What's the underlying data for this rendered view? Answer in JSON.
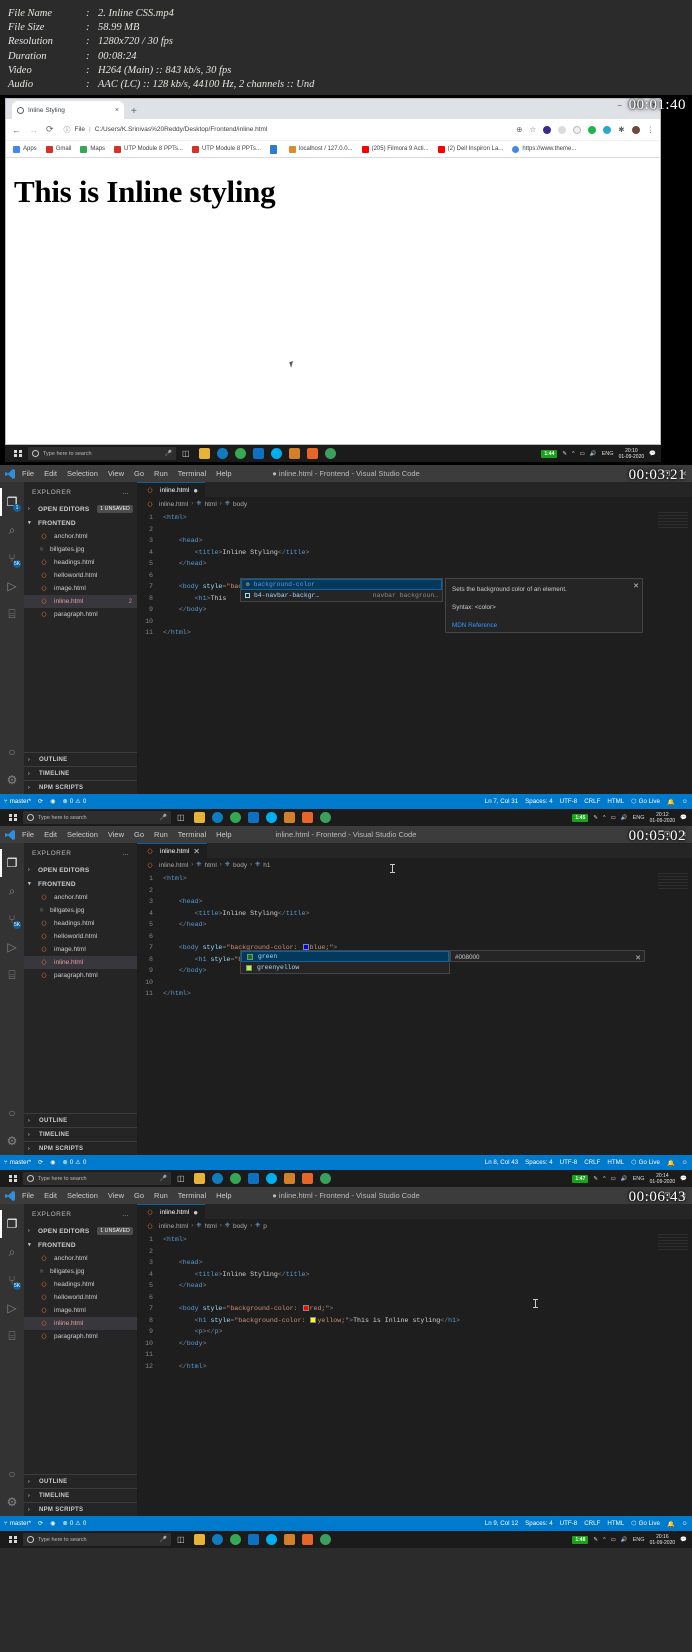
{
  "meta": {
    "rows": [
      {
        "key": "File Name",
        "sep": ":",
        "value": "2. Inline CSS.mp4"
      },
      {
        "key": "File Size",
        "sep": ":",
        "value": "58.99 MB"
      },
      {
        "key": "Resolution",
        "sep": ":",
        "value": "1280x720 / 30 fps"
      },
      {
        "key": "Duration",
        "sep": ":",
        "value": "00:08:24"
      },
      {
        "key": "Video",
        "sep": ":",
        "value": "H264 (Main) :: 843 kb/s, 30 fps"
      },
      {
        "key": "Audio",
        "sep": ":",
        "value": "AAC (LC) :: 128 kb/s, 44100 Hz, 2 channels :: Und"
      }
    ]
  },
  "panels": [
    {
      "timestamp": "00:01:40"
    },
    {
      "timestamp": "00:03:21"
    },
    {
      "timestamp": "00:05:02"
    },
    {
      "timestamp": "00:06:43"
    }
  ],
  "browser": {
    "tab_title": "Inline Styling",
    "tab_close": "×",
    "new_tab": "+",
    "window_min": "–",
    "window_max": "☐",
    "window_close": "×",
    "back": "←",
    "forward": "→",
    "reload": "⟳",
    "security_label": "File",
    "separator": "|",
    "url": "C:/Users/K.Srinivas%20Reddy/Desktop/Frontend/inline.html",
    "zoom_icon": "⊕",
    "star_icon": "☆",
    "menu_icon": "⋮",
    "bookmarks": [
      {
        "label": "Apps",
        "color": "#4285f4"
      },
      {
        "label": "Gmail",
        "color": "#d93025"
      },
      {
        "label": "Maps",
        "color": "#34a853"
      },
      {
        "label": "UTP Module 8 PPTs...",
        "color": "#d93025"
      },
      {
        "label": "UTP Module 8 PPTs...",
        "color": "#d93025"
      },
      {
        "label": "",
        "color": "#2b7cd3"
      },
      {
        "label": "localhost / 127.0.0...",
        "color": "#e08b2a"
      },
      {
        "label": "(205) Filmora 9 Acti...",
        "color": "#ff0000"
      },
      {
        "label": "(2) Dell Inspiron La...",
        "color": "#ff0000"
      },
      {
        "label": "https://www.theme...",
        "color": "#4285f4"
      }
    ],
    "page_heading": "This is Inline styling"
  },
  "taskbar": {
    "search_placeholder": "Type here to search",
    "mic_icon": "ᴿ",
    "taskview_icon": "❐",
    "apps": [
      {
        "name": "file-explorer-icon",
        "color": "#e8b339"
      },
      {
        "name": "edge-icon",
        "color": "#0f7cbf"
      },
      {
        "name": "chrome-icon",
        "color": "#34a853"
      },
      {
        "name": "vscode-icon",
        "color": "#0e70c0"
      },
      {
        "name": "skype-icon",
        "color": "#00aff0"
      },
      {
        "name": "photos-icon",
        "color": "#d4802a"
      },
      {
        "name": "filmora-icon",
        "color": "#e8652a"
      },
      {
        "name": "browser2-icon",
        "color": "#3ba05b"
      }
    ],
    "battery": "1:44",
    "lang": "ENG",
    "time": "20:10",
    "date": "01-09-2020",
    "battery_panels": [
      "1:44",
      "1:45",
      "1:47",
      "1:48"
    ],
    "times": [
      "20:10",
      "20:12",
      "20:14",
      "20:16"
    ],
    "dates": [
      "01-09-2020",
      "01-09-2020",
      "01-09-2020",
      "01-09-2020"
    ]
  },
  "vscode": {
    "menus": [
      "File",
      "Edit",
      "Selection",
      "View",
      "Go",
      "Run",
      "Terminal",
      "Help"
    ],
    "window_title": "inline.html - Frontend - Visual Studio Code",
    "window_title_dirty_dot": "●",
    "win_min": "—",
    "win_max": "❐",
    "win_close": "✕",
    "activity_icons": [
      {
        "name": "explorer-icon",
        "glyph": "❐",
        "badge": "1"
      },
      {
        "name": "search-icon",
        "glyph": "⌕",
        "badge": ""
      },
      {
        "name": "source-control-icon",
        "glyph": "⑂",
        "badge": "5K"
      },
      {
        "name": "run-debug-icon",
        "glyph": "▷",
        "badge": ""
      },
      {
        "name": "extensions-icon",
        "glyph": "⌸",
        "badge": ""
      }
    ],
    "account_icon": "○",
    "settings_icon": "⚙",
    "explorer_label": "EXPLORER",
    "explorer_more": "…",
    "open_editors": "OPEN EDITORS",
    "folder_name": "FRONTEND",
    "files": [
      {
        "name": "anchor.html",
        "type": "html",
        "count": ""
      },
      {
        "name": "billgates.jpg",
        "type": "img",
        "count": ""
      },
      {
        "name": "headings.html",
        "type": "html",
        "count": ""
      },
      {
        "name": "helloworld.html",
        "type": "html",
        "count": ""
      },
      {
        "name": "image.html",
        "type": "html",
        "count": ""
      },
      {
        "name": "inline.html",
        "type": "html",
        "count": "2"
      },
      {
        "name": "paragraph.html",
        "type": "html",
        "count": ""
      }
    ],
    "bottom_panes": [
      "OUTLINE",
      "TIMELINE",
      "NPM SCRIPTS"
    ],
    "tab_name": "inline.html",
    "tab_dirty": "●",
    "tab_close": "✕",
    "chev": "›",
    "file_icon_glyph": "‹›"
  },
  "panel2": {
    "timestamp": "00:03:21",
    "unsaved_badge": "1 UNSAVED",
    "breadcrumb": [
      "inline.html",
      "html",
      "body"
    ],
    "editor_dirty": true,
    "lines": [
      {
        "n": "1",
        "code": "<html>"
      },
      {
        "n": "2",
        "code": ""
      },
      {
        "n": "3",
        "code": "    <head>"
      },
      {
        "n": "4",
        "code": "        <title>Inline Styling</title>"
      },
      {
        "n": "5",
        "code": "    </head>"
      },
      {
        "n": "6",
        "code": ""
      },
      {
        "n": "7",
        "code": "    <body style=\"backgroundcol\">"
      },
      {
        "n": "8",
        "code": "        <h1>This is Inline styling</h1>"
      },
      {
        "n": "9",
        "code": "    </body>"
      },
      {
        "n": "10",
        "code": ""
      },
      {
        "n": "11",
        "code": "</html>"
      }
    ],
    "autocomplete": {
      "items": [
        {
          "label": "background-color",
          "highlight": "background-col",
          "detail": "",
          "icon": "wrench",
          "selected": true
        },
        {
          "label": "b4-navbar-backgr…",
          "highlight": "b4-navbar-backgr",
          "detail": "navbar backgroun…",
          "icon": "box",
          "selected": false
        }
      ],
      "doc_title": "Sets the background color of an element.",
      "doc_syntax": "Syntax: <color>",
      "doc_link": "MDN Reference",
      "doc_close": "✕"
    },
    "status": {
      "branch": "master*",
      "sync_icon": "⟳",
      "eye_icon": "◉",
      "errors": "0",
      "warnings": "0",
      "error_icon": "⊗",
      "warn_icon": "⚠",
      "position": "Ln 7, Col 31",
      "spaces": "Spaces: 4",
      "encoding": "UTF-8",
      "eol": "CRLF",
      "language": "HTML",
      "golive": "Go Live",
      "golive_icon": "⬡",
      "bell_icon": "ὑ4",
      "feedback_icon": "☺"
    },
    "problems_count": "2"
  },
  "panel3": {
    "timestamp": "00:05:02",
    "breadcrumb": [
      "inline.html",
      "html",
      "body",
      "h1"
    ],
    "lines": [
      {
        "n": "1",
        "code": "<html>"
      },
      {
        "n": "2",
        "code": ""
      },
      {
        "n": "3",
        "code": "    <head>"
      },
      {
        "n": "4",
        "code": "        <title>Inline Styling</title>"
      },
      {
        "n": "5",
        "code": "    </head>"
      },
      {
        "n": "6",
        "code": ""
      },
      {
        "n": "7",
        "code": "    <body style=\"background-color: blue;\">"
      },
      {
        "n": "8",
        "code": "        <h1 style=\"background-color: green;\">This is Inline styling</h1>"
      },
      {
        "n": "9",
        "code": "    </body>"
      },
      {
        "n": "10",
        "code": ""
      },
      {
        "n": "11",
        "code": "</html>"
      }
    ],
    "body_color": "blue",
    "body_swatch": "#0000ff",
    "h1_color": "green",
    "h1_swatch": "#008000",
    "autocomplete": {
      "items": [
        {
          "label": "green",
          "swatch": "#008000",
          "selected": true
        },
        {
          "label": "greenyellow",
          "highlight": "green",
          "swatch": "#adff2f",
          "selected": false
        }
      ],
      "value": "#008000",
      "doc_close": "✕"
    },
    "status": {
      "branch": "master*",
      "errors": "0",
      "warnings": "0",
      "position": "Ln 8, Col 43",
      "spaces": "Spaces: 4",
      "encoding": "UTF-8",
      "eol": "CRLF",
      "language": "HTML",
      "golive": "Go Live"
    }
  },
  "panel4": {
    "timestamp": "00:06:43",
    "unsaved_badge": "1 UNSAVED",
    "breadcrumb": [
      "inline.html",
      "html",
      "body",
      "p"
    ],
    "lines": [
      {
        "n": "1",
        "code": "<html>"
      },
      {
        "n": "2",
        "code": ""
      },
      {
        "n": "3",
        "code": "    <head>"
      },
      {
        "n": "4",
        "code": "        <title>Inline Styling</title>"
      },
      {
        "n": "5",
        "code": "    </head>"
      },
      {
        "n": "6",
        "code": ""
      },
      {
        "n": "7",
        "code": "    <body style=\"background-color: red;\">"
      },
      {
        "n": "8",
        "code": "        <h1 style=\"background-color: yellow;\">This is Inline styling</h1>"
      },
      {
        "n": "9",
        "code": "        <p></p>"
      },
      {
        "n": "10",
        "code": "    </body>"
      },
      {
        "n": "11",
        "code": ""
      },
      {
        "n": "12",
        "code": "</html>"
      }
    ],
    "body_color": "red",
    "body_swatch": "#ff0000",
    "h1_color": "yellow",
    "h1_swatch": "#ffff00",
    "status": {
      "branch": "master*",
      "errors": "0",
      "warnings": "0",
      "position": "Ln 9, Col 12",
      "spaces": "Spaces: 4",
      "encoding": "UTF-8",
      "eol": "CRLF",
      "language": "HTML",
      "golive": "Go Live"
    }
  }
}
